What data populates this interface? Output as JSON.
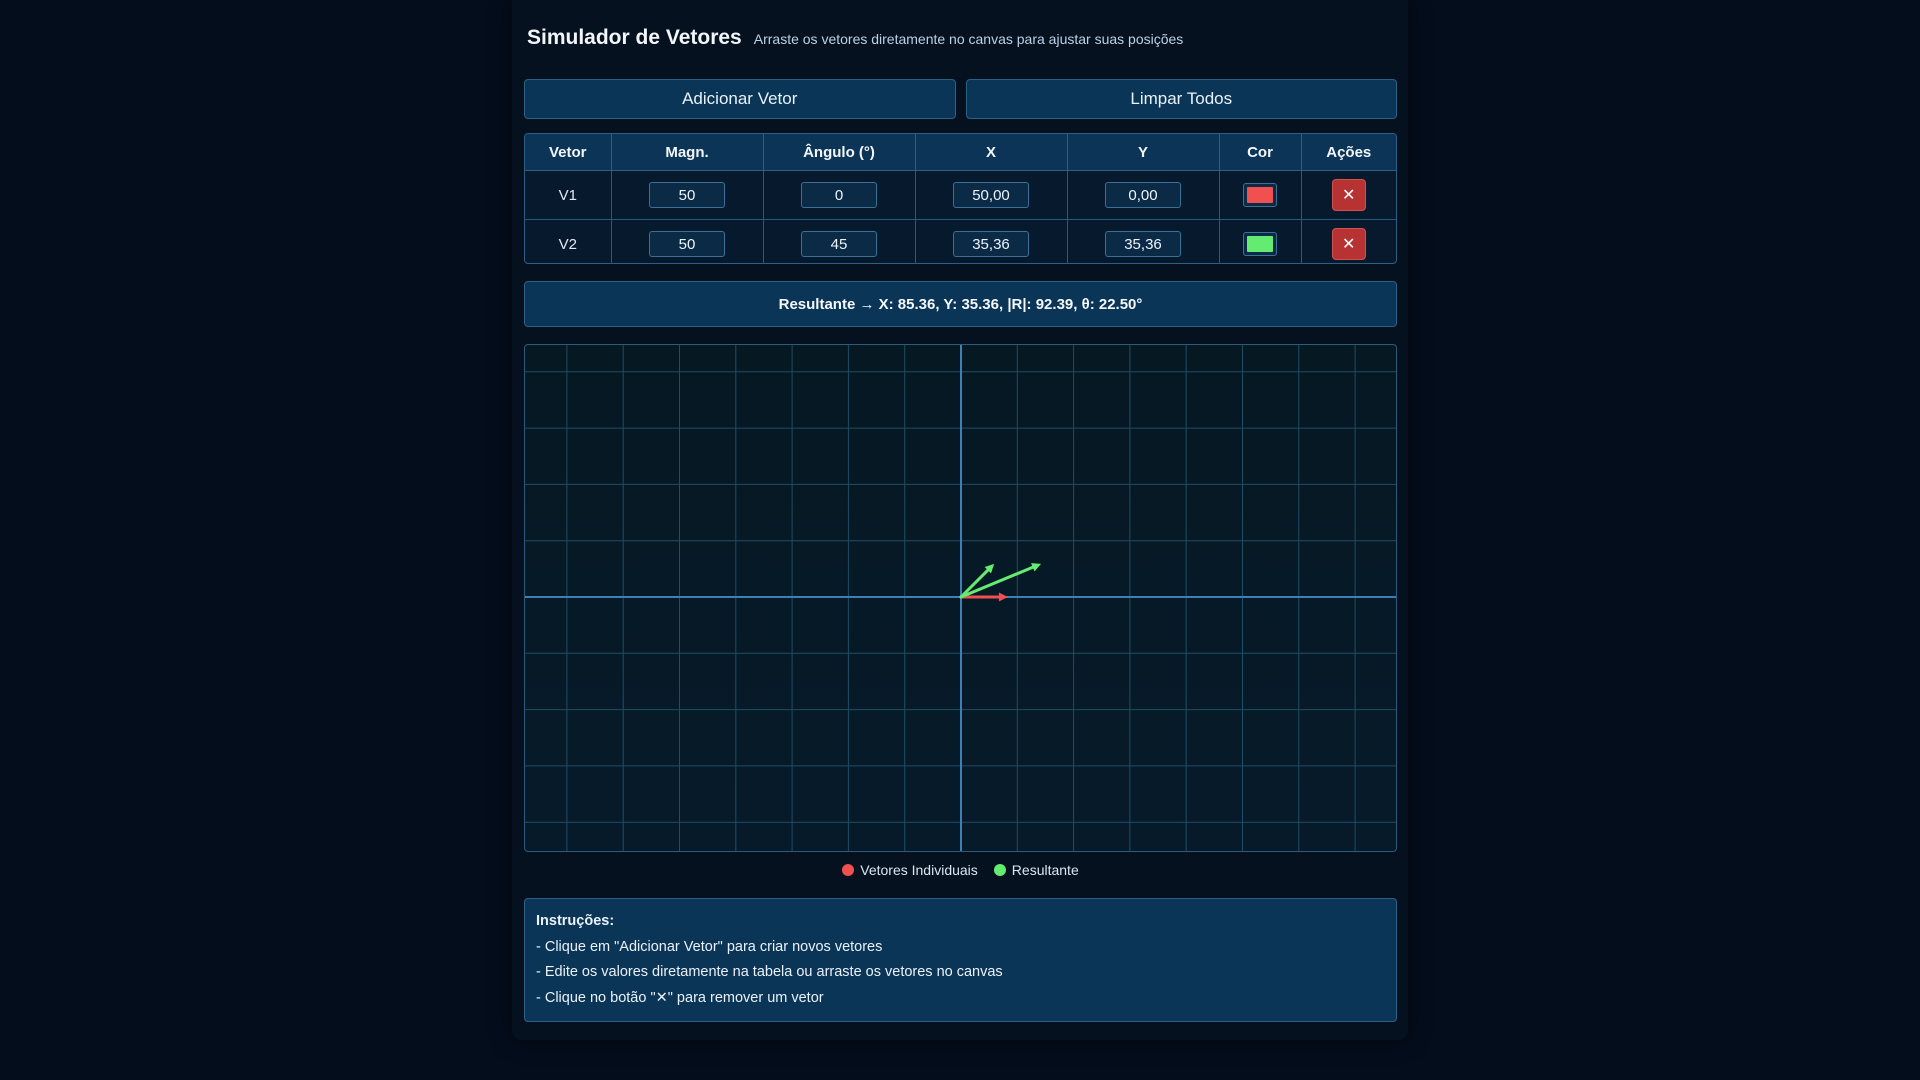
{
  "header": {
    "title": "Simulador de Vetores",
    "subtitle": "Arraste os vetores diretamente no canvas para ajustar suas posições"
  },
  "buttons": {
    "add": "Adicionar Vetor",
    "clear": "Limpar Todos"
  },
  "table": {
    "headers": [
      "Vetor",
      "Magn.",
      "Ângulo (°)",
      "X",
      "Y",
      "Cor",
      "Ações"
    ],
    "rows": [
      {
        "name": "V1",
        "magnitude": "50",
        "angle": "0",
        "x": "50,00",
        "y": "0,00",
        "color": "#f0504f",
        "delete_icon": "✕"
      },
      {
        "name": "V2",
        "magnitude": "50",
        "angle": "45",
        "x": "35,36",
        "y": "35,36",
        "color": "#64ec72",
        "delete_icon": "✕"
      }
    ]
  },
  "resultant": {
    "text": "Resultante → X: 85.36, Y: 35.36, |R|: 92.39, θ: 22.50°",
    "x": 85.36,
    "y": 35.36,
    "magnitude": 92.39,
    "angle": 22.5
  },
  "canvas": {
    "vectors": [
      {
        "name": "V1",
        "x": 50,
        "y": 0,
        "color": "#f0504f"
      },
      {
        "name": "V2",
        "x": 35.36,
        "y": 35.36,
        "color": "#64ec72"
      }
    ],
    "resultant_color": "#64ec72",
    "grid_color": "#1f4d66",
    "axis_color": "#3f7fb8"
  },
  "legend": {
    "individual": {
      "label": "Vetores Individuais",
      "color": "#f0504f"
    },
    "resultant": {
      "label": "Resultante",
      "color": "#64ec72"
    }
  },
  "instructions": {
    "title": "Instruções:",
    "lines": [
      "- Clique em \"Adicionar Vetor\" para criar novos vetores",
      "- Edite os valores diretamente na tabela ou arraste os vetores no canvas",
      "- Clique no botão \"✕\" para remover um vetor"
    ]
  }
}
